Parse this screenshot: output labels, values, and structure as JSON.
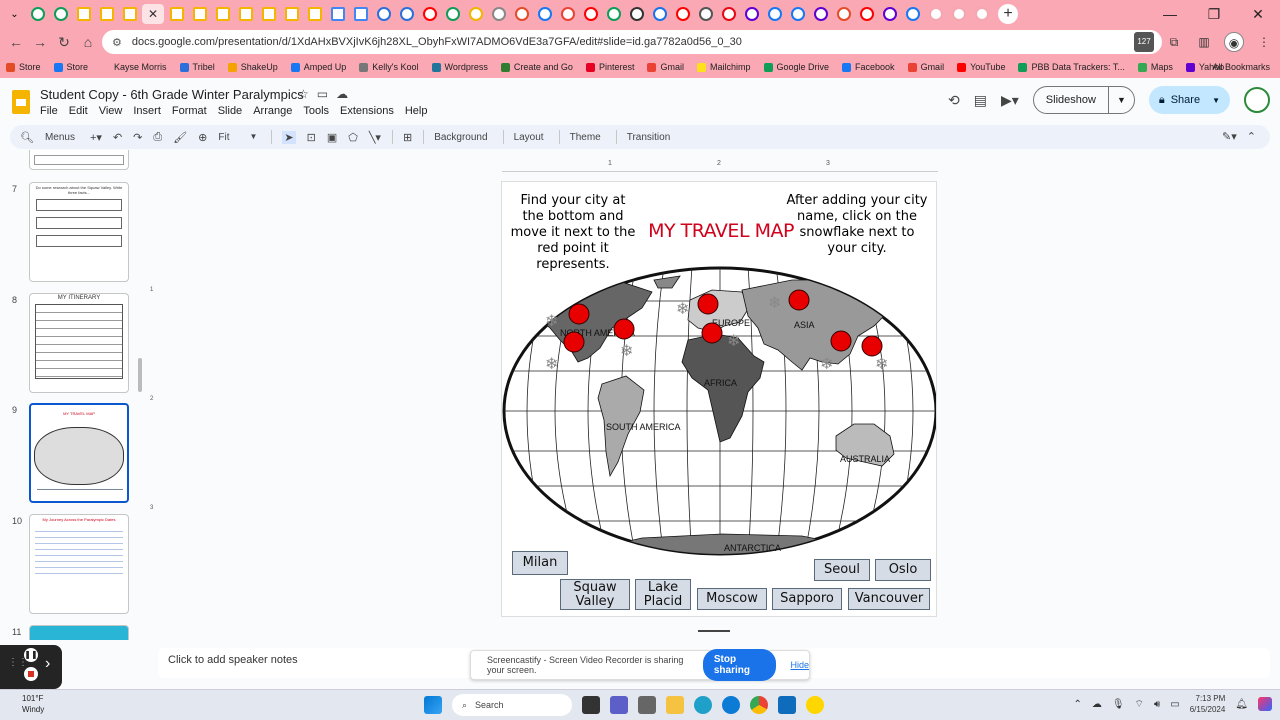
{
  "browser": {
    "url": "docs.google.com/presentation/d/1XdAHxBVXjIvK6jh28XL_ObyhFxWI7ADMO6VdE3a7GFA/edit#slide=id.ga7782a0d56_0_30",
    "bookmarks": [
      {
        "label": "Store",
        "color": "#e34c26"
      },
      {
        "label": "Store",
        "color": "#1877f2"
      },
      {
        "label": "Kayse Morris",
        "color": ""
      },
      {
        "label": "Tribel",
        "color": "#2a6fdb"
      },
      {
        "label": "ShakeUp",
        "color": "#f4a300"
      },
      {
        "label": "Amped Up",
        "color": "#1877f2"
      },
      {
        "label": "Kelly's Kool",
        "color": "#777"
      },
      {
        "label": "Wordpress",
        "color": "#21759b"
      },
      {
        "label": "Create and Go",
        "color": "#2f7d32"
      },
      {
        "label": "Pinterest",
        "color": "#e60023"
      },
      {
        "label": "Gmail",
        "color": "#ea4335"
      },
      {
        "label": "Mailchimp",
        "color": "#ffe01b"
      },
      {
        "label": "Google Drive",
        "color": "#0f9d58"
      },
      {
        "label": "Facebook",
        "color": "#1877f2"
      },
      {
        "label": "Gmail",
        "color": "#ea4335"
      },
      {
        "label": "YouTube",
        "color": "#ff0000"
      },
      {
        "label": "PBB Data Trackers: T...",
        "color": "#0f9d58"
      },
      {
        "label": "Maps",
        "color": "#34a853"
      },
      {
        "label": "Yahoo",
        "color": "#6001d2"
      }
    ],
    "all_bookmarks": "All Bookmarks"
  },
  "doc": {
    "title": "Student Copy - 6th Grade Winter Paralympics",
    "menus": [
      "File",
      "Edit",
      "View",
      "Insert",
      "Format",
      "Slide",
      "Arrange",
      "Tools",
      "Extensions",
      "Help"
    ],
    "slideshow_label": "Slideshow",
    "share_label": "Share"
  },
  "toolbar": {
    "menus_label": "Menus",
    "zoom_label": "Fit",
    "background_label": "Background",
    "layout_label": "Layout",
    "theme_label": "Theme",
    "transition_label": "Transition"
  },
  "filmstrip": {
    "slides": [
      {
        "num": "7",
        "text": "Do some research about the Squaw Valley. Write three facts..."
      },
      {
        "num": "8",
        "text": "MY ITINERARY"
      },
      {
        "num": "9",
        "text": "MY TRAVEL MAP"
      },
      {
        "num": "10",
        "text": "My Journey Across the Paralympic Dates"
      },
      {
        "num": "11",
        "text": ""
      }
    ]
  },
  "ruler": {
    "marks": [
      "1",
      "2",
      "3"
    ]
  },
  "slide": {
    "instructions_left": "Find your city at the bottom and move it next to the red point it represents.",
    "instructions_right": "After adding your city name, click on the snowflake next to your city.",
    "title": "MY TRAVEL MAP",
    "continents": [
      "NORTH AMERICA",
      "EUROPE",
      "ASIA",
      "AFRICA",
      "SOUTH AMERICA",
      "AUSTRALIA",
      "ANTARCTICA"
    ],
    "cities": [
      "Milan",
      "Seoul",
      "Oslo",
      "Squaw Valley",
      "Lake Placid",
      "Moscow",
      "Sapporo",
      "Vancouver"
    ]
  },
  "notes": {
    "placeholder": "Click to add speaker notes"
  },
  "screencast": {
    "message": "Screencastify - Screen Video Recorder is sharing your screen.",
    "stop_label": "Stop sharing",
    "hide_label": "Hide"
  },
  "taskbar": {
    "temperature": "101°F",
    "weather": "Windy",
    "search_placeholder": "Search",
    "time": "7:13 PM",
    "date": "6/15/2024"
  }
}
